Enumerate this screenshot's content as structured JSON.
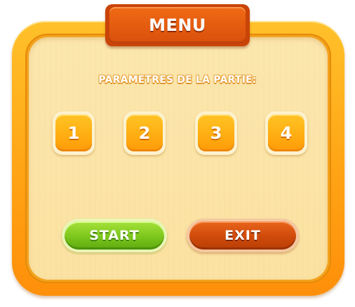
{
  "menu": {
    "title": "MENU",
    "subtitle": "PARAMETRES DE LA PARTIE:"
  },
  "options": [
    {
      "label": "1"
    },
    {
      "label": "2"
    },
    {
      "label": "3"
    },
    {
      "label": "4"
    }
  ],
  "actions": {
    "start_label": "START",
    "exit_label": "EXIT"
  },
  "colors": {
    "frame": "#ffa414",
    "panel": "#fbe3a6",
    "ribbon": "#d8500c",
    "start": "#7cc61c",
    "exit": "#cf4a0a"
  }
}
